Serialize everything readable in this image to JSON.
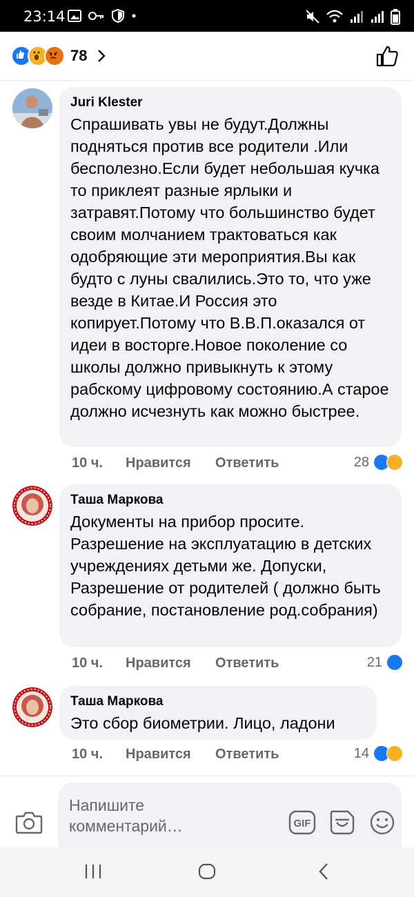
{
  "status_bar": {
    "time": "23:14"
  },
  "reactions_bar": {
    "count": "78"
  },
  "comments": [
    {
      "author": "Juri Klester",
      "text": "Спрашивать увы не будут.Должны подняться против все родители .Или бесполезно.Если будет небольшая кучка то приклеят разные ярлыки и затравят.Потому что большинство будет своим молчанием трактоваться как одобряющие эти мероприятия.Вы как будто с луны свалились.Это то, что уже везде в Китае.И Россия это копирует.Потому что В.В.П.оказался от идеи в восторге.Новое поколение со школы должно привыкнуть к этому рабскому цифровому состоянию.А старое должно исчезнуть как можно быстрее.",
      "time": "10 ч.",
      "like_label": "Нравится",
      "reply_label": "Ответить",
      "reaction_count": "28"
    },
    {
      "author": "Таша Маркова",
      "text": "Документы на прибор просите. Разрешение на эксплуатацию в детских учреждениях детьми же. Допуски, Разрешение от родителей ( должно быть собрание, постановление род.собрания)",
      "time": "10 ч.",
      "like_label": "Нравится",
      "reply_label": "Ответить",
      "reaction_count": "21"
    },
    {
      "author": "Таша Маркова",
      "text": "Это сбор биометрии. Лицо, ладони",
      "time": "10 ч.",
      "like_label": "Нравится",
      "reply_label": "Ответить",
      "reaction_count": "14"
    }
  ],
  "composer": {
    "placeholder": "Напишите комментарий…",
    "gif_label": "GIF"
  },
  "icons": {
    "reactions": [
      "like-icon",
      "wow-icon",
      "angry-icon"
    ],
    "comment_1_reactions": [
      "like-icon",
      "sad-icon"
    ],
    "comment_2_reactions": [
      "like-icon"
    ],
    "comment_3_reactions": [
      "like-icon",
      "sad-icon"
    ]
  },
  "colors": {
    "facebook_blue": "#1877f2",
    "bubble_bg": "#f0f2f5",
    "meta_gray": "#65676b"
  }
}
